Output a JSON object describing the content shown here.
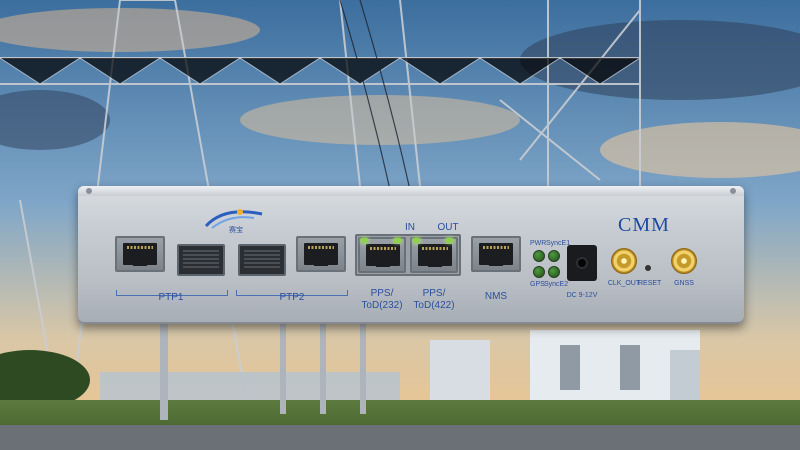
{
  "device": {
    "brand_title": "CMM",
    "logo_text": "赛宝",
    "port_labels": {
      "ptp1": "PTP1",
      "ptp2": "PTP2",
      "pps_232_line1": "PPS/",
      "pps_232_line2": "ToD(232)",
      "pps_422_line1": "PPS/",
      "pps_422_line2": "ToD(422)",
      "in": "IN",
      "out": "OUT",
      "nms": "NMS",
      "pwr": "PWR",
      "sync_e1": "SyncE1",
      "gps": "GPS",
      "sync_e2": "SyncE2",
      "dc": "DC 9-12V",
      "clk_out": "CLK_OUT",
      "reset": "RESET",
      "gnss": "GNSS"
    }
  },
  "colors": {
    "label_blue": "#2a4f9c",
    "led_green": "#8fd14f",
    "sky_top": "#3c6e9e",
    "sky_bottom": "#f0c48a"
  },
  "icons": [
    "logo-swoosh-icon",
    "rj45-port-icon",
    "sfp-port-icon",
    "sma-connector-icon",
    "dc-jack-icon"
  ]
}
